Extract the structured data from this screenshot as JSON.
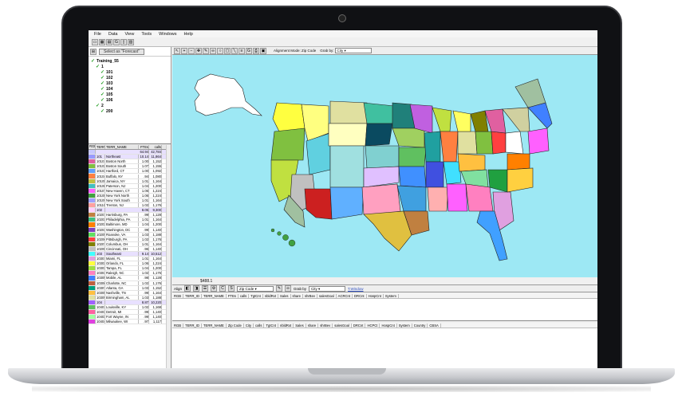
{
  "menu": [
    "File",
    "Data",
    "View",
    "Tools",
    "Windows",
    "Help"
  ],
  "left_panel": {
    "select_button": "Select as \"Forecast\"",
    "tree": [
      {
        "label": "Training_55",
        "level": 0
      },
      {
        "label": "1",
        "level": 1
      },
      {
        "label": "101",
        "level": 2
      },
      {
        "label": "102",
        "level": 2
      },
      {
        "label": "103",
        "level": 2
      },
      {
        "label": "104",
        "level": 2
      },
      {
        "label": "105",
        "level": 2
      },
      {
        "label": "106",
        "level": 2
      },
      {
        "label": "2",
        "level": 1
      },
      {
        "label": "200",
        "level": 2
      }
    ],
    "columns": [
      "RGB",
      "TERR_ID",
      "TERR_NAME",
      "FTEs",
      "calls"
    ],
    "rows": [
      {
        "color": "#c8c8ff",
        "id": "",
        "name": "",
        "fte": "64.94",
        "calls": "42,784"
      },
      {
        "color": "#9999ff",
        "id": "101",
        "name": "Northeast",
        "fte": "10.14",
        "calls": "11,864"
      },
      {
        "color": "#e060a0",
        "id": "10101",
        "name": "Boston North",
        "fte": "1.00",
        "calls": "1,152"
      },
      {
        "color": "#80c040",
        "id": "10102",
        "name": "Boston South",
        "fte": "1.07",
        "calls": "1,155"
      },
      {
        "color": "#60a0ff",
        "id": "10103",
        "name": "Hartford, CT",
        "fte": "1.00",
        "calls": "1,092"
      },
      {
        "color": "#ff8040",
        "id": "10104",
        "name": "Buffalo, NY",
        "fte": ".94",
        "calls": "1,080"
      },
      {
        "color": "#c0c040",
        "id": "10105",
        "name": "Jamaica, NY",
        "fte": "1.01",
        "calls": "1,164"
      },
      {
        "color": "#40c0c0",
        "id": "10106",
        "name": "Paterson, NJ",
        "fte": "1.04",
        "calls": "1,200"
      },
      {
        "color": "#ff60ff",
        "id": "10107",
        "name": "New Haven, CT",
        "fte": "1.06",
        "calls": "1,224"
      },
      {
        "color": "#40a040",
        "id": "10108",
        "name": "New York North",
        "fte": "1.06",
        "calls": "1,224"
      },
      {
        "color": "#a0a0ff",
        "id": "10109",
        "name": "New York South",
        "fte": "1.01",
        "calls": "1,164"
      },
      {
        "color": "#ffa0a0",
        "id": "10110",
        "name": "Trenton, NJ",
        "fte": "1.02",
        "calls": "1,176"
      },
      {
        "color": "#ffd0ff",
        "id": "102",
        "name": "",
        "fte": "8.05",
        "calls": "9,300"
      },
      {
        "color": "#c08040",
        "id": "10201",
        "name": "Harrisburg, PA",
        "fte": ".99",
        "calls": "1,128"
      },
      {
        "color": "#40c080",
        "id": "10202",
        "name": "Philadelphia, PA",
        "fte": "1.01",
        "calls": "1,164"
      },
      {
        "color": "#ff8000",
        "id": "10203",
        "name": "Baltimore, MD",
        "fte": "1.04",
        "calls": "1,200"
      },
      {
        "color": "#8040c0",
        "id": "10204",
        "name": "Washington, DC",
        "fte": ".99",
        "calls": "1,140"
      },
      {
        "color": "#60e060",
        "id": "10205",
        "name": "Roanoke, VA",
        "fte": "1.03",
        "calls": "1,188"
      },
      {
        "color": "#ff4040",
        "id": "10206",
        "name": "Pittsburgh, PA",
        "fte": "1.02",
        "calls": "1,176"
      },
      {
        "color": "#808000",
        "id": "10207",
        "name": "Columbus, OH",
        "fte": "1.01",
        "calls": "1,164"
      },
      {
        "color": "#c0c0c0",
        "id": "10208",
        "name": "Cincinnati, OH",
        "fte": ".96",
        "calls": "1,140"
      },
      {
        "color": "#40ffff",
        "id": "103",
        "name": "Southeast",
        "fte": "9.14",
        "calls": "10,512"
      },
      {
        "color": "#e0a0e0",
        "id": "10301",
        "name": "Miami, FL",
        "fte": "1.01",
        "calls": "1,164"
      },
      {
        "color": "#ffff40",
        "id": "10302",
        "name": "Orlando, FL",
        "fte": "1.06",
        "calls": "1,224"
      },
      {
        "color": "#a0e040",
        "id": "10303",
        "name": "Tampa, FL",
        "fte": "1.04",
        "calls": "1,200"
      },
      {
        "color": "#ff80c0",
        "id": "10304",
        "name": "Raleigh, NC",
        "fte": "1.02",
        "calls": "1,176"
      },
      {
        "color": "#4080ff",
        "id": "10305",
        "name": "Mobile, AL",
        "fte": ".98",
        "calls": "1,128"
      },
      {
        "color": "#c06040",
        "id": "10306",
        "name": "Charlotte, NC",
        "fte": "1.02",
        "calls": "1,176"
      },
      {
        "color": "#00a080",
        "id": "10307",
        "name": "Atlanta, GA",
        "fte": "1.03",
        "calls": "1,152"
      },
      {
        "color": "#ffc040",
        "id": "10308",
        "name": "Nashville, TN",
        "fte": ".99",
        "calls": "1,164"
      },
      {
        "color": "#e0e0a0",
        "id": "10309",
        "name": "Birmingham, AL",
        "fte": "1.03",
        "calls": "1,188"
      },
      {
        "color": "#a060ff",
        "id": "104",
        "name": "",
        "fte": "8.87",
        "calls": "10,220"
      },
      {
        "color": "#60c060",
        "id": "10401",
        "name": "Louisville, KY",
        "fte": "1.02",
        "calls": "1,168"
      },
      {
        "color": "#ff60a0",
        "id": "10402",
        "name": "Detroit, MI",
        "fte": ".99",
        "calls": "1,140"
      },
      {
        "color": "#a0ffa0",
        "id": "10403",
        "name": "Fort Wayne, IN",
        "fte": ".99",
        "calls": "1,140"
      },
      {
        "color": "#e040e0",
        "id": "10404",
        "name": "Milwaukee, WI",
        "fte": ".97",
        "calls": "1,117"
      }
    ]
  },
  "map_toolbar": {
    "alignment_label": "Alignment Mode: Zip Code",
    "grab_label": "Grab by:",
    "grab_value": "City"
  },
  "map_status": "$488.1",
  "panel_toolbar": {
    "align_label": "Align",
    "zip_value": "Zip Code",
    "grab_label": "Grab by",
    "grab_value": "City",
    "window_label": "T.Window"
  },
  "upper_panel_columns": [
    "RGB",
    "TERR_ID",
    "TERR_NAME",
    "FTEs",
    "calls",
    "TgtCnt",
    "nbldRxt",
    "Sales",
    "share",
    "shrBev",
    "salesGoal",
    "ACRCnt",
    "DRCnt",
    "HospCnt",
    "System"
  ],
  "lower_panel_columns": [
    "RGB",
    "TERR_ID",
    "TERR_NAME",
    "Zip Code",
    "City",
    "calls",
    "TgtCnt",
    "nbldRxt",
    "Sales",
    "share",
    "shrBev",
    "salesGoal",
    "DRCnt",
    "HCPCt",
    "HospCnt",
    "System",
    "Country",
    "CBSA"
  ],
  "map_colors": {
    "ocean": "#9de8f4",
    "alaska": "#ffffff",
    "hawaii": "#40a040"
  }
}
